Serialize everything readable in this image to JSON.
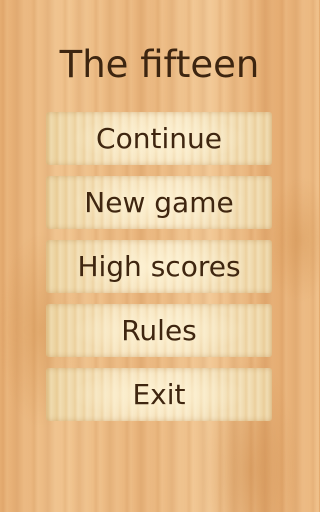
{
  "title": "The fifteen",
  "menu": {
    "items": [
      {
        "label": "Continue"
      },
      {
        "label": "New game"
      },
      {
        "label": "High scores"
      },
      {
        "label": "Rules"
      },
      {
        "label": "Exit"
      }
    ]
  },
  "colors": {
    "background": "#e8b37a",
    "button": "#f4dfb4",
    "text": "#3f2610"
  }
}
